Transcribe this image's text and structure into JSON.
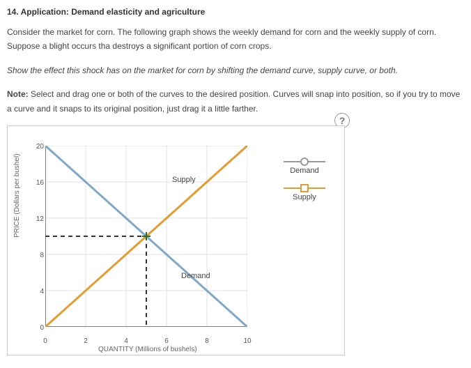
{
  "title": "14. Application: Demand elasticity and agriculture",
  "para1": "Consider the market for corn. The following graph shows the weekly demand for corn and the weekly supply of corn. Suppose a blight occurs tha destroys a significant portion of corn crops.",
  "instruction": "Show the effect this shock has on the market for corn by shifting the demand curve, supply curve, or both.",
  "note_label": "Note:",
  "note_text": " Select and drag one or both of the curves to the desired position. Curves will snap into position, so if you try to move a curve and it snaps to its original position, just drag it a little farther.",
  "help_icon": "?",
  "legend": {
    "demand": "Demand",
    "supply": "Supply"
  },
  "chart_data": {
    "type": "line",
    "xlabel": "QUANTITY (Millions of bushels)",
    "ylabel": "PRICE (Dollars per bushel)",
    "xticks": [
      0,
      2,
      4,
      6,
      8,
      10
    ],
    "yticks": [
      0,
      4,
      8,
      12,
      16,
      20
    ],
    "xlim": [
      0,
      10
    ],
    "ylim": [
      0,
      20
    ],
    "series": [
      {
        "name": "Demand",
        "color": "#7fa7c9",
        "points": [
          [
            0,
            20
          ],
          [
            10,
            0
          ]
        ]
      },
      {
        "name": "Supply",
        "color": "#e49b2f",
        "points": [
          [
            0,
            0
          ],
          [
            10,
            20
          ]
        ]
      }
    ],
    "equilibrium": {
      "x": 5,
      "y": 10
    },
    "inline_labels": {
      "supply": "Supply",
      "demand": "Demand"
    }
  }
}
